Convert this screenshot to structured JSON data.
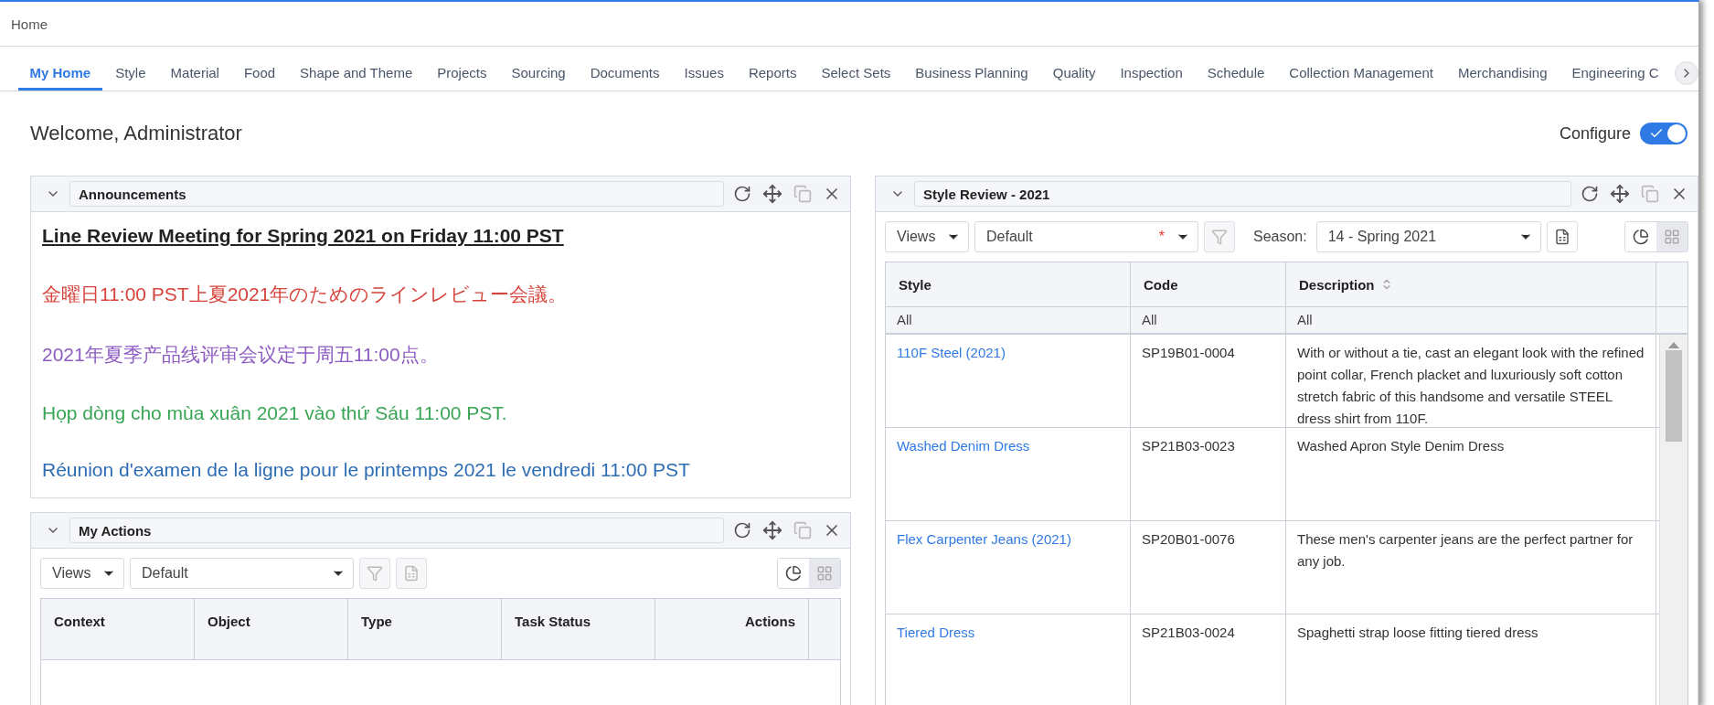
{
  "top_bar": {
    "title": "Home"
  },
  "tabs": [
    {
      "label": "My Home",
      "selected": true
    },
    {
      "label": "Style",
      "selected": false
    },
    {
      "label": "Material",
      "selected": false
    },
    {
      "label": "Food",
      "selected": false
    },
    {
      "label": "Shape and Theme",
      "selected": false
    },
    {
      "label": "Projects",
      "selected": false
    },
    {
      "label": "Sourcing",
      "selected": false
    },
    {
      "label": "Documents",
      "selected": false
    },
    {
      "label": "Issues",
      "selected": false
    },
    {
      "label": "Reports",
      "selected": false
    },
    {
      "label": "Select Sets",
      "selected": false
    },
    {
      "label": "Business Planning",
      "selected": false
    },
    {
      "label": "Quality",
      "selected": false
    },
    {
      "label": "Inspection",
      "selected": false
    },
    {
      "label": "Schedule",
      "selected": false
    },
    {
      "label": "Collection Management",
      "selected": false
    },
    {
      "label": "Merchandising",
      "selected": false
    },
    {
      "label": "Engineering C",
      "selected": false
    }
  ],
  "welcome": "Welcome, Administrator",
  "configure": {
    "label": "Configure",
    "on": true
  },
  "announcements": {
    "title": "Announcements",
    "lines": [
      {
        "kind": "heading",
        "text": "Line Review Meeting for Spring 2021 on Friday 11:00 PST",
        "color": "#222222"
      },
      {
        "kind": "text",
        "text": "金曜日11:00 PST上夏2021年のためのラインレビュー会議。",
        "color": "#d6453d"
      },
      {
        "kind": "text",
        "text": "2021年夏季产品线评审会议定于周五11:00点。",
        "color": "#8e5cc2"
      },
      {
        "kind": "text",
        "text": "Họp dòng cho mùa xuân 2021 vào thứ Sáu 11:00 PST.",
        "color": "#3aa655"
      },
      {
        "kind": "text",
        "text": "Réunion d'examen de la ligne pour le printemps 2021 le vendredi 11:00 PST",
        "color": "#2e6db4"
      }
    ]
  },
  "my_actions": {
    "title": "My Actions",
    "views": "Views",
    "view_value": "Default",
    "view_toggles": [
      {
        "kind": "chart",
        "selected": false
      },
      {
        "kind": "grid",
        "selected": true
      }
    ],
    "columns": [
      "Context",
      "Object",
      "Type",
      "Task Status",
      "Actions"
    ]
  },
  "style_review": {
    "title": "Style Review - 2021",
    "views": "Views",
    "view_value": "Default",
    "required_mark": "*",
    "season_label": "Season:",
    "season_value": "14 - Spring 2021",
    "view_toggles": [
      {
        "kind": "chart",
        "selected": false
      },
      {
        "kind": "grid",
        "selected": true
      }
    ],
    "columns": [
      "Style",
      "Code",
      "Description"
    ],
    "filters": [
      "All",
      "All",
      "All"
    ],
    "rows": [
      {
        "style": "110F Steel (2021)",
        "code": "SP19B01-0004",
        "description": "With or without a tie, cast an elegant look with the refined point collar, French placket and luxuriously soft cotton stretch fabric of this handsome and versatile STEEL dress shirt from 110F."
      },
      {
        "style": "Washed Denim Dress",
        "code": "SP21B03-0023",
        "description": "Washed Apron Style Denim Dress"
      },
      {
        "style": "Flex Carpenter Jeans (2021)",
        "code": "SP20B01-0076",
        "description": "These men's carpenter jeans are the perfect partner for any job."
      },
      {
        "style": "Tiered Dress",
        "code": "SP21B03-0024",
        "description": "Spaghetti strap loose fitting tiered dress"
      }
    ]
  }
}
